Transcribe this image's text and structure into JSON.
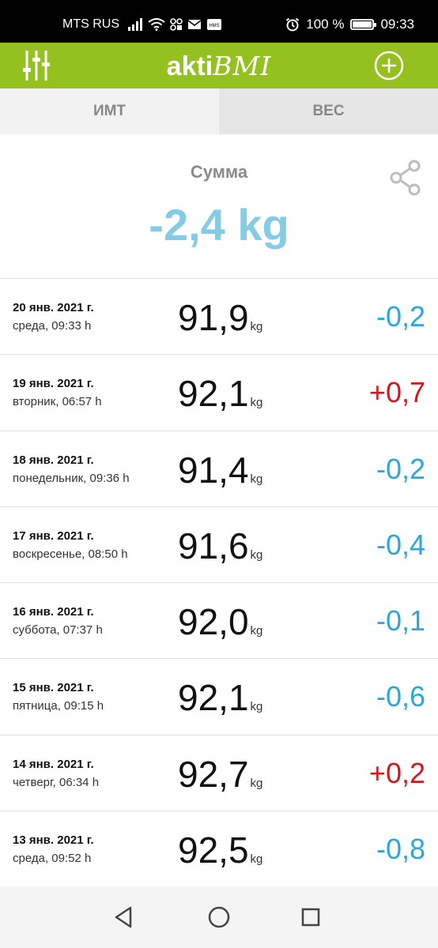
{
  "status_bar": {
    "carrier": "MTS RUS",
    "battery": "100 %",
    "battery_level": 1.0,
    "time": "09:33",
    "icons": [
      "signal-icon",
      "wifi-icon",
      "chat-icon",
      "sms-icon",
      "hms-icon",
      "alarm-icon",
      "battery-icon"
    ]
  },
  "app_bar": {
    "logo_prefix": "akti",
    "logo_suffix": "BMI",
    "background": "#94c11f",
    "icons": [
      "filter-sliders-icon",
      "add-circle-icon"
    ]
  },
  "tabs": [
    {
      "label": "ИМТ",
      "active": true
    },
    {
      "label": "ВЕС",
      "active": false
    }
  ],
  "summary": {
    "label": "Сумма",
    "value": "-2,4 kg",
    "icon": "share-icon"
  },
  "entries": [
    {
      "date": "20 янв. 2021 г.",
      "day": "среда, 09:33 h",
      "weight": "91,9",
      "unit": "kg",
      "diff": "-0,2",
      "trend": "down"
    },
    {
      "date": "19 янв. 2021 г.",
      "day": "вторник, 06:57 h",
      "weight": "92,1",
      "unit": "kg",
      "diff": "+0,7",
      "trend": "up"
    },
    {
      "date": "18 янв. 2021 г.",
      "day": "понедельник, 09:36 h",
      "weight": "91,4",
      "unit": "kg",
      "diff": "-0,2",
      "trend": "down"
    },
    {
      "date": "17 янв. 2021 г.",
      "day": "воскресенье, 08:50 h",
      "weight": "91,6",
      "unit": "kg",
      "diff": "-0,4",
      "trend": "down"
    },
    {
      "date": "16 янв. 2021 г.",
      "day": "суббота, 07:37 h",
      "weight": "92,0",
      "unit": "kg",
      "diff": "-0,1",
      "trend": "down"
    },
    {
      "date": "15 янв. 2021 г.",
      "day": "пятница, 09:15 h",
      "weight": "92,1",
      "unit": "kg",
      "diff": "-0,6",
      "trend": "down"
    },
    {
      "date": "14 янв. 2021 г.",
      "day": "четверг, 06:34 h",
      "weight": "92,7",
      "unit": "kg",
      "diff": "+0,2",
      "trend": "up"
    },
    {
      "date": "13 янв. 2021 г.",
      "day": "среда, 09:52 h",
      "weight": "92,5",
      "unit": "kg",
      "diff": "-0,8",
      "trend": "down"
    }
  ],
  "nav_bar": {
    "icons": [
      "back-triangle-icon",
      "home-circle-icon",
      "recents-square-icon"
    ]
  },
  "colors": {
    "accent": "#94c11f",
    "summary_value": "#86cbe5",
    "negative": "#2aa8dc",
    "positive": "#d0191f"
  }
}
